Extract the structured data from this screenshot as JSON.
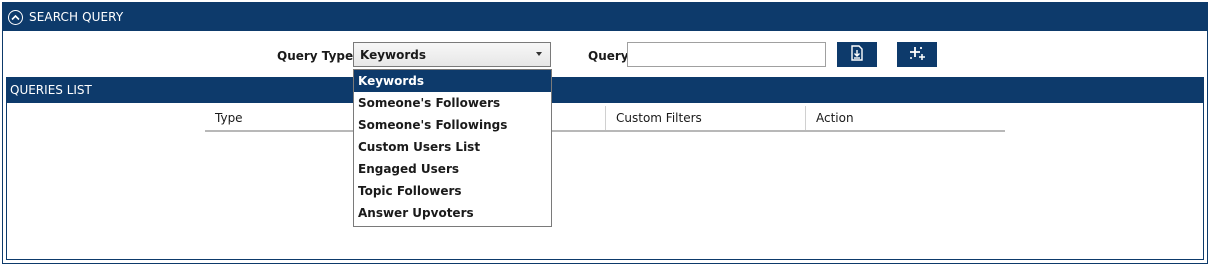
{
  "search": {
    "title": "SEARCH QUERY",
    "query_type_label": "Query Type",
    "query_type_value": "Keywords",
    "query_label": "Query",
    "query_value": "",
    "query_placeholder": ""
  },
  "dropdown": {
    "options": [
      {
        "label": "Keywords",
        "selected": true
      },
      {
        "label": "Someone's Followers",
        "selected": false
      },
      {
        "label": "Someone's Followings",
        "selected": false
      },
      {
        "label": "Custom Users List",
        "selected": false
      },
      {
        "label": "Engaged Users",
        "selected": false
      },
      {
        "label": "Topic Followers",
        "selected": false
      },
      {
        "label": "Answer Upvoters",
        "selected": false
      }
    ]
  },
  "queries": {
    "title": "QUERIES LIST",
    "columns": [
      "Type",
      "",
      "Custom Filters",
      "Action"
    ]
  },
  "icons": {
    "collapse": "chevron-up-circle-icon",
    "import": "import-file-icon",
    "add": "add-sparkle-icon"
  },
  "colors": {
    "brand": "#0d3a6b",
    "selected": "#0d3a6b"
  }
}
